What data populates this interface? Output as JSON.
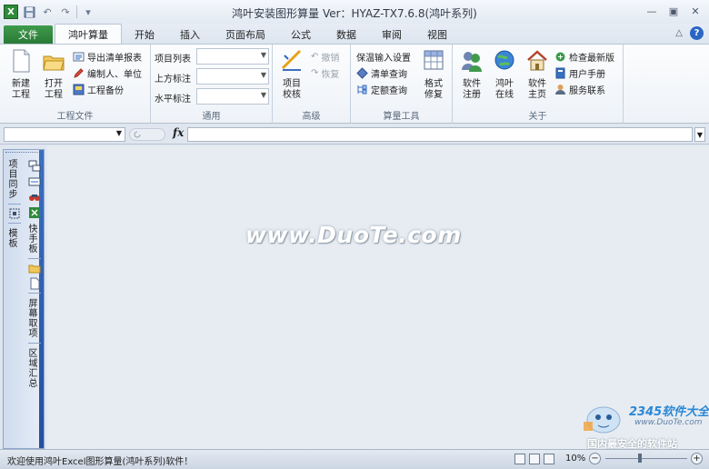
{
  "window": {
    "title": "鸿叶安装图形算量  Ver：HYAZ-TX7.6.8(鸿叶系列)",
    "minimize": "—",
    "restore": "▣",
    "close": "✕",
    "app_icon": "excel-icon",
    "app_icon_glyph": "X"
  },
  "quick_access": {
    "undo": "↶",
    "redo": "↷",
    "customize": "▾"
  },
  "tabs": [
    {
      "label": "文件"
    },
    {
      "label": "鸿叶算量"
    },
    {
      "label": "开始"
    },
    {
      "label": "插入"
    },
    {
      "label": "页面布局"
    },
    {
      "label": "公式"
    },
    {
      "label": "数据"
    },
    {
      "label": "审阅"
    },
    {
      "label": "视图"
    }
  ],
  "ribbon_controls": {
    "collapse": "△",
    "help": "?"
  },
  "ribbon": {
    "project_group": {
      "label": "工程文件",
      "new_line1": "新建",
      "new_line2": "工程",
      "open_line1": "打开",
      "open_line2": "工程",
      "export": "导出清单报表",
      "editor": "编制人、单位",
      "backup": "工程备份"
    },
    "general_group": {
      "label": "通用",
      "item_list": "项目列表",
      "top_label": "上方标注",
      "horizontal_label": "水平标注",
      "item_list_value": "",
      "top_label_value": "",
      "horizontal_label_value": ""
    },
    "advanced_group": {
      "label": "高级",
      "check_line1": "项目",
      "check_line2": "校核",
      "undo": "撤销",
      "redo": "恢复"
    },
    "tools_group": {
      "label": "算量工具",
      "insulation": "保温输入设置",
      "list_query": "清单查询",
      "quota_query": "定额查询",
      "format_line1": "格式",
      "format_line2": "修复"
    },
    "about_group": {
      "label": "关于",
      "register_line1": "软件",
      "register_line2": "注册",
      "online_line1": "鸿叶",
      "online_line2": "在线",
      "home_line1": "软件",
      "home_line2": "主页",
      "update": "检查最新版",
      "manual": "用户手册",
      "contact": "服务联系"
    }
  },
  "formula_bar": {
    "name_box": "",
    "fx": "fx",
    "formula": ""
  },
  "sidebar": {
    "sync": "项目同步",
    "template": "模板",
    "quick_board": "快手板",
    "screen_pick": "屏幕取项",
    "region_summary": "区域汇总"
  },
  "workspace": {
    "watermark": "www.DuoTe.com"
  },
  "logo": {
    "number": "2345软件大全",
    "site": "www.DuoTe.com",
    "slogan": "国内最安全的软件站"
  },
  "status": {
    "text": "欢迎使用鸿叶Excel图形算量(鸿叶系列)软件！",
    "zoom": "10%",
    "zoom_level_percent": 10
  },
  "colors": {
    "file_tab": "#2a7a36",
    "help": "#2a66c4",
    "sidebar_accent": "#2450a0"
  }
}
